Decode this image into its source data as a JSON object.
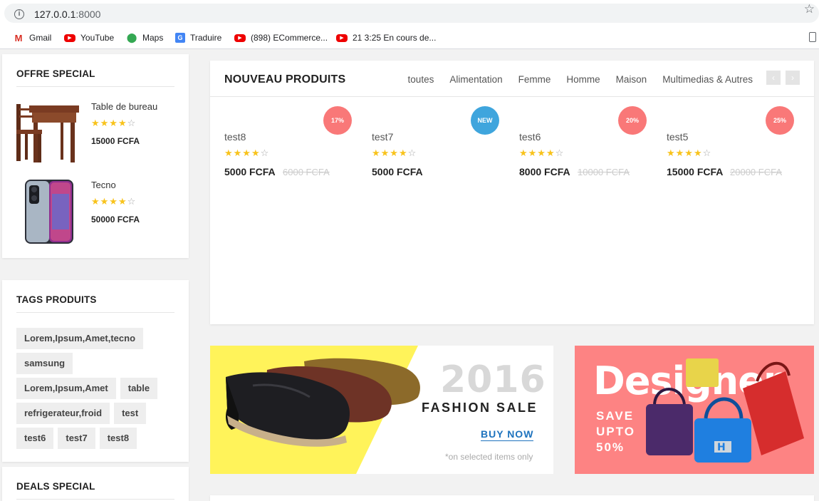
{
  "browser": {
    "url_host": "127.0.0.1",
    "url_port": ":8000",
    "bookmarks": [
      {
        "label": "Gmail",
        "icon": "gmail-icon"
      },
      {
        "label": "YouTube",
        "icon": "youtube-icon"
      },
      {
        "label": "Maps",
        "icon": "maps-icon"
      },
      {
        "label": "Traduire",
        "icon": "translate-icon"
      },
      {
        "label": "(898) ECommerce...",
        "icon": "youtube-icon"
      },
      {
        "label": "21 3:25 En cours de...",
        "icon": "youtube-icon"
      }
    ]
  },
  "offre_special": {
    "title": "OFFRE SPECIAL",
    "items": [
      {
        "name": "Table de bureau",
        "rating": 4,
        "price": "15000 FCFA"
      },
      {
        "name": "Tecno",
        "rating": 4,
        "price": "50000 FCFA"
      }
    ]
  },
  "tags_produits": {
    "title": "TAGS PRODUITS",
    "tags": [
      "Lorem,Ipsum,Amet,tecno",
      "samsung",
      "Lorem,Ipsum,Amet",
      "table",
      "refrigerateur,froid",
      "test",
      "test6",
      "test7",
      "test8"
    ]
  },
  "deals_special": {
    "title": "DEALS SPECIAL"
  },
  "nouveau_produits": {
    "title": "NOUVEAU PRODUITS",
    "tabs": [
      "toutes",
      "Alimentation",
      "Femme",
      "Homme",
      "Maison",
      "Multimedias & Autres"
    ],
    "prev_label": "‹",
    "next_label": "›",
    "products": [
      {
        "name": "test8",
        "badge": "17%",
        "badge_color": "#f97878",
        "rating": 4,
        "price": "5000 FCFA",
        "old_price": "6000 FCFA"
      },
      {
        "name": "test7",
        "badge": "NEW",
        "badge_color": "#3fa5dd",
        "rating": 4,
        "price": "5000 FCFA",
        "old_price": ""
      },
      {
        "name": "test6",
        "badge": "20%",
        "badge_color": "#f97878",
        "rating": 4,
        "price": "8000 FCFA",
        "old_price": "10000 FCFA"
      },
      {
        "name": "test5",
        "badge": "25%",
        "badge_color": "#f97878",
        "rating": 4,
        "price": "15000 FCFA",
        "old_price": "20000 FCFA"
      }
    ]
  },
  "banner_fashion": {
    "year": "2016",
    "headline": "FASHION SALE",
    "cta": "BUY NOW",
    "note": "*on selected items only",
    "bg_color": "#fff35a"
  },
  "banner_designer": {
    "word": "Designer",
    "save_line1": "SAVE",
    "save_line2": "UPTO",
    "save_line3": "50%",
    "bg_color": "#fd8383"
  },
  "colors": {
    "star": "#f8c31c",
    "accent_blue": "#1e73be",
    "badge_red": "#f97878",
    "badge_blue": "#3fa5dd"
  }
}
